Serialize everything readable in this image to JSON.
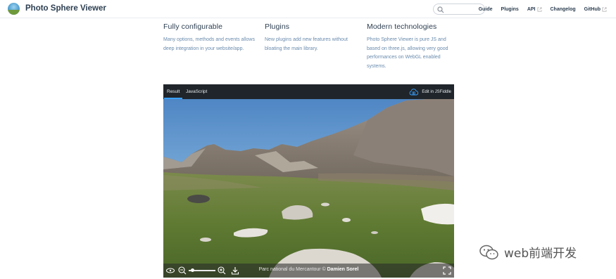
{
  "header": {
    "site_name": "Photo Sphere Viewer",
    "search": {
      "value": "",
      "placeholder": ""
    },
    "nav": [
      {
        "label": "Guide",
        "external": false
      },
      {
        "label": "Plugins",
        "external": false
      },
      {
        "label": "API",
        "external": true
      },
      {
        "label": "Changelog",
        "external": false
      },
      {
        "label": "GitHub",
        "external": true
      }
    ]
  },
  "features": [
    {
      "title": "Fully configurable",
      "text": "Many options, methods and events allows deep integration in your website/app."
    },
    {
      "title": "Plugins",
      "text": "New plugins add new features without bloating the main library."
    },
    {
      "title": "Modern technologies",
      "text": "Photo Sphere Viewer is pure JS and based on three.js, allowing very good performances on WebGL enabled systems."
    }
  ],
  "fiddle": {
    "tabs": [
      {
        "label": "Result",
        "active": true
      },
      {
        "label": "JavaScript",
        "active": false
      }
    ],
    "edit_link": "Edit in JSFiddle"
  },
  "viewer": {
    "caption_prefix": "Parc national du Mercantour © ",
    "caption_author": "Damien Sorel",
    "zoom_level": 0.1,
    "buttons": [
      "autorotate-icon",
      "zoom-out-icon",
      "zoom-in-icon",
      "download-icon",
      "fullscreen-icon"
    ]
  },
  "watermark": {
    "text": "web前端开发"
  },
  "colors": {
    "text": "#2c3e50",
    "muted": "#6a8bad",
    "fiddle_bar": "#1f252b",
    "accent": "#3aa0ff"
  }
}
